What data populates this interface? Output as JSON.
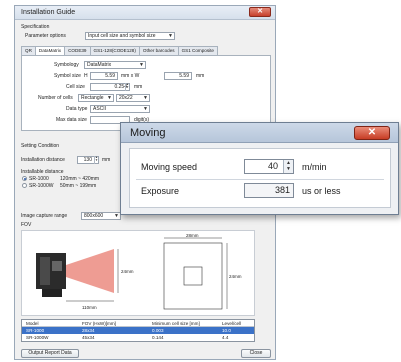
{
  "window": {
    "title": "Installation Guide",
    "close_glyph": "✕"
  },
  "specification": {
    "group_label": "Specification",
    "param_options_label": "Parameter options",
    "param_options_value": "Input cell size and symbol size"
  },
  "tabs": [
    "QR",
    "DataMatrix",
    "CODE39",
    "GS1-128(CODE128)",
    "Other barcodes",
    "GS1 Composite"
  ],
  "datamatrix": {
    "symbology_label": "Symbology",
    "symbology_value": "DataMatrix",
    "symbol_size_label": "Symbol size",
    "symbol_size_x_prefix": "H",
    "symbol_size_x": "5.59",
    "symbol_size_mid": "mm x W",
    "symbol_size_y": "5.59",
    "symbol_size_unit": "mm",
    "cell_size_label": "Cell size",
    "cell_size_value": "0.254",
    "cell_size_unit": "mm",
    "num_cells_label": "Number of cells",
    "num_cells_shape": "Rectangle",
    "num_cells_value": "20x22",
    "data_type_label": "Data type",
    "data_type_value": "ASCII",
    "max_data_label": "Max data size",
    "max_data_unit": "digit(s)"
  },
  "setting_condition": {
    "group_label": "Setting Condition",
    "install_distance_label": "Installation distance",
    "install_distance_value": "130",
    "install_distance_unit": "mm",
    "install_note_label": "Installable distance",
    "radio_1_label": "SR-1000",
    "radio_1_range": "120mm ~ 420mm",
    "radio_2_label": "SR-1000W",
    "radio_2_range": "50mm ~ 199mm",
    "capture_range_label": "Image capture range",
    "capture_range_value": "800x600",
    "fov_label": "FOV"
  },
  "fov_diagram": {
    "top_dim": "28mm",
    "side_dim": "24mm",
    "right_dim": "24mm",
    "distance_dim": "110mm"
  },
  "results_table": {
    "headers": [
      "Model",
      "FOV (HxW)[mm]",
      "Minimum cell size [mm]",
      "Level/cell"
    ],
    "rows": [
      [
        "SR-1000",
        "28x34",
        "0.003",
        "10.0"
      ],
      [
        "SR-1000W",
        "45x34",
        "0.144",
        "4.4"
      ]
    ]
  },
  "footer": {
    "output_button": "Output Report Data",
    "close_button": "Close"
  },
  "moving_dialog": {
    "title": "Moving",
    "close_glyph": "✕",
    "speed_label": "Moving speed",
    "speed_value": "40",
    "speed_unit": "m/min",
    "exposure_label": "Exposure",
    "exposure_value": "381",
    "exposure_unit": "us or less"
  },
  "colors": {
    "close_red": "#c63c24",
    "selection_blue": "#3b72c8",
    "beam_red": "#e04a3a"
  }
}
